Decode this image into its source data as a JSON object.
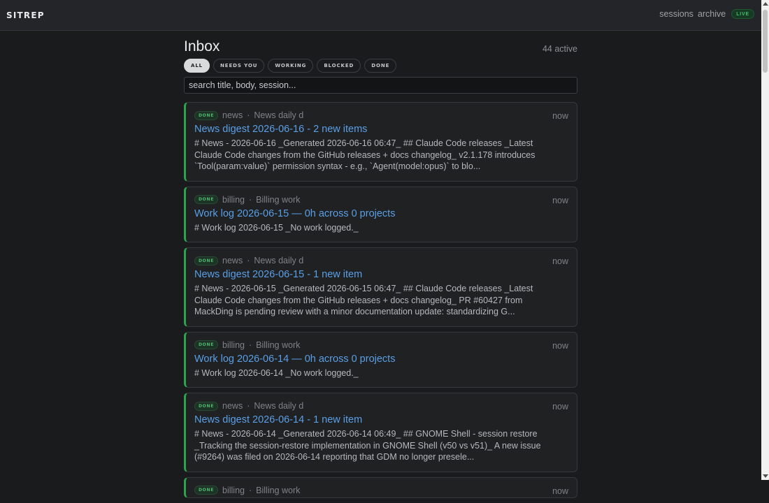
{
  "topbar": {
    "brand": "SITREP",
    "nav": {
      "sessions": "sessions",
      "archive": "archive",
      "live": "LIVE"
    }
  },
  "main": {
    "title": "Inbox",
    "active_count": "44 active",
    "filters": [
      "ALL",
      "NEEDS YOU",
      "WORKING",
      "BLOCKED",
      "DONE"
    ],
    "active_filter": "ALL",
    "search": {
      "placeholder": "search title, body, session...",
      "value": ""
    }
  },
  "cards": [
    {
      "status": "DONE",
      "source": "news",
      "session": "News daily d",
      "time": "now",
      "title": "News digest 2026-06-16 - 2 new items",
      "body": "# News - 2026-06-16 _Generated 2026-06-16 06:47_ ## Claude Code releases _Latest Claude Code changes from the GitHub releases + docs changelog_ v2.1.178 introduces `Tool(param:value)` permission syntax - e.g., `Agent(model:opus)` to blo..."
    },
    {
      "status": "DONE",
      "source": "billing",
      "session": "Billing work",
      "time": "now",
      "title": "Work log 2026-06-15 — 0h across 0 projects",
      "body": "# Work log 2026-06-15 _No work logged._"
    },
    {
      "status": "DONE",
      "source": "news",
      "session": "News daily d",
      "time": "now",
      "title": "News digest 2026-06-15 - 1 new item",
      "body": "# News - 2026-06-15 _Generated 2026-06-15 06:47_ ## Claude Code releases _Latest Claude Code changes from the GitHub releases + docs changelog_ PR #60427 from MackDing is pending review with a minor documentation update: standardizing G..."
    },
    {
      "status": "DONE",
      "source": "billing",
      "session": "Billing work",
      "time": "now",
      "title": "Work log 2026-06-14 — 0h across 0 projects",
      "body": "# Work log 2026-06-14 _No work logged._"
    },
    {
      "status": "DONE",
      "source": "news",
      "session": "News daily d",
      "time": "now",
      "title": "News digest 2026-06-14 - 1 new item",
      "body": "# News - 2026-06-14 _Generated 2026-06-14 06:49_ ## GNOME Shell - session restore _Tracking the session-restore implementation in GNOME Shell (v50 vs v51)_ A new issue (#9264) was filed on 2026-06-14 reporting that GDM no longer presele..."
    },
    {
      "status": "DONE",
      "source": "billing",
      "session": "Billing work",
      "time": "now",
      "title": "",
      "body": ""
    }
  ]
}
